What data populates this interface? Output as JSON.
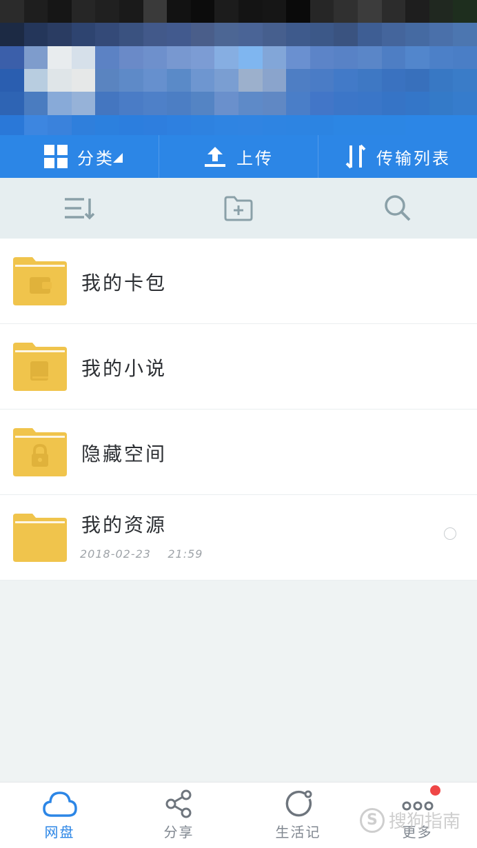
{
  "topbar": {
    "category_label": "分类",
    "upload_label": "上传",
    "transfer_label": "传输列表"
  },
  "toolbar": {
    "sort_icon": "sort-icon",
    "new_folder_icon": "new-folder-icon",
    "search_icon": "search-icon"
  },
  "files": [
    {
      "name": "我的卡包",
      "date": "",
      "icon": "wallet-icon"
    },
    {
      "name": "我的小说",
      "date": "",
      "icon": "book-icon"
    },
    {
      "name": "隐藏空间",
      "date": "",
      "icon": "lock-icon"
    },
    {
      "name": "我的资源",
      "date": "2018-02-23    21:59",
      "icon": ""
    }
  ],
  "bottom_nav": [
    {
      "label": "网盘",
      "icon": "cloud-icon",
      "active": true
    },
    {
      "label": "分享",
      "icon": "share-icon",
      "active": false
    },
    {
      "label": "生活记",
      "icon": "life-record-icon",
      "active": false
    },
    {
      "label": "更多",
      "icon": "more-icon",
      "active": false
    }
  ],
  "watermark": {
    "text": "搜狗指南"
  },
  "colors": {
    "accent": "#2c86e6",
    "folder": "#f0c44c",
    "badge": "#ef4646"
  }
}
